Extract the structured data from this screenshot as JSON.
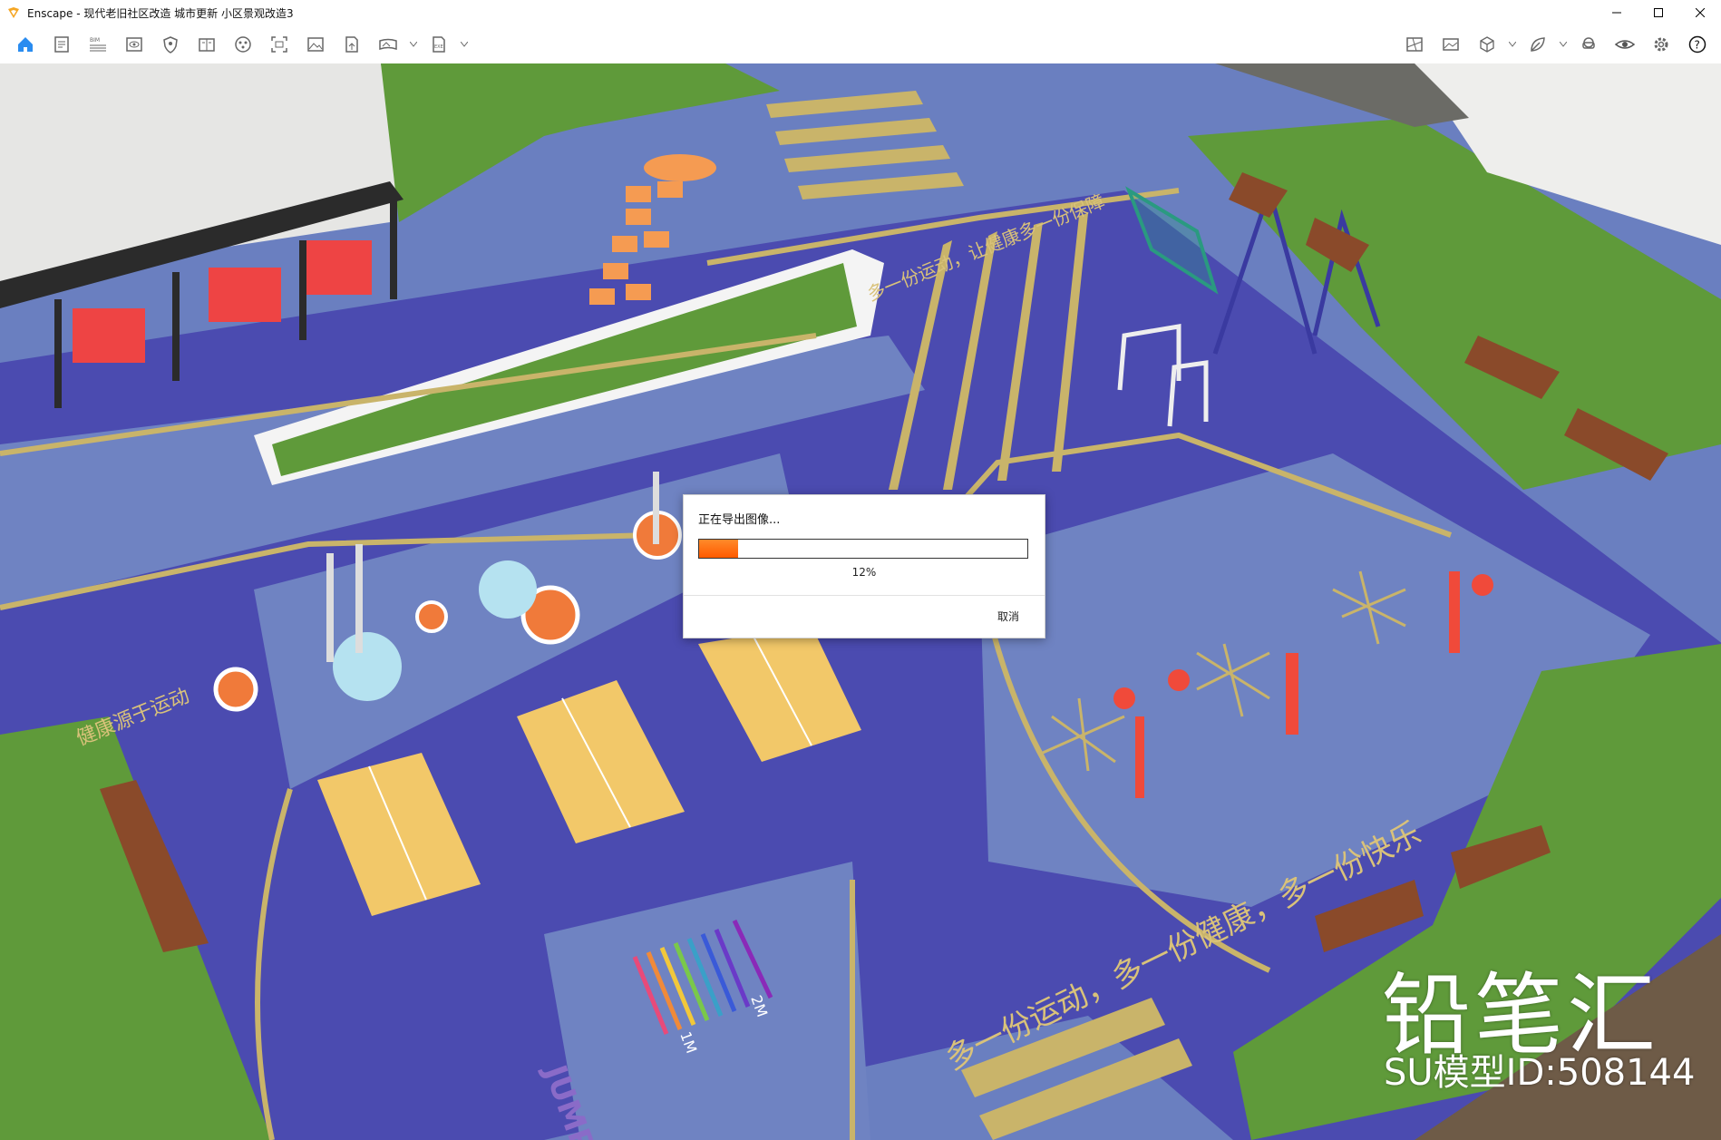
{
  "window": {
    "title": "Enscape - 现代老旧社区改造 城市更新 小区景观改造3",
    "controls": [
      "minimize-icon",
      "maximize-icon",
      "close-icon"
    ]
  },
  "toolbar": {
    "left_icons": [
      "home-icon",
      "document-icon",
      "bim-icon",
      "view-icon",
      "shield-icon",
      "book-icon",
      "asset-library-icon",
      "screenshot-icon",
      "image-icon",
      "file-export-icon",
      "panorama-icon",
      "exe-export-icon"
    ],
    "bim_label": "BIM",
    "exe_label": "EXE",
    "right_icons": [
      "map-icon",
      "gallery-icon",
      "cube-icon",
      "leaf-icon",
      "vr-headset-icon",
      "visual-settings-icon",
      "settings-icon",
      "help-icon"
    ]
  },
  "dialog": {
    "title": "正在导出图像...",
    "progress": 12,
    "progress_label": "12%",
    "cancel_label": "取消"
  },
  "scene": {
    "slogan_top": "多一份运动，让健康多一份保障",
    "slogan_left": "健康源于运动",
    "slogan_bottom": "多一份运动，多一份健康，多一份快乐",
    "jump_label": "JUMP",
    "mark_1m": "1M",
    "mark_2m": "2M"
  },
  "watermark": {
    "brand": "铅笔汇",
    "model_id": "SU模型ID:508144"
  },
  "colors": {
    "accent_orange": "#ff5a00",
    "court_purple": "#4b4bb0",
    "path_blue": "#6f83c2",
    "grass": "#5f9a3a",
    "line_gold": "#c9b46a"
  }
}
